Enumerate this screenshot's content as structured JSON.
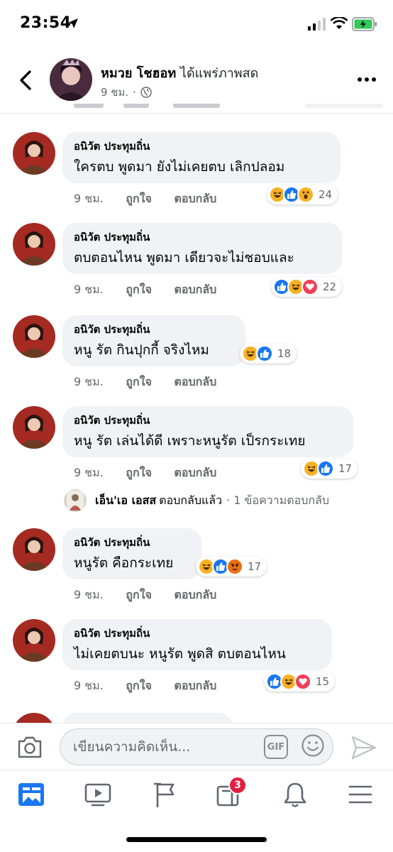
{
  "status_bar": {
    "time": "23:54"
  },
  "header": {
    "name": "หมวย โชฮอท",
    "action": "ได้แพร่ภาพสด",
    "time": "9 ชม.",
    "separator": "·"
  },
  "comments": [
    {
      "author": "อนิวัต ประทุมถิ่น",
      "text": "ใครตบ พูดมา ยังไม่เคยตบ เลิกปลอม",
      "time": "9 ชม.",
      "like_label": "ถูกใจ",
      "reply_label": "ตอบกลับ",
      "reactions": [
        "haha",
        "like",
        "wow"
      ],
      "reaction_count": "24"
    },
    {
      "author": "อนิวัต ประทุมถิ่น",
      "text": "ตบตอนไหน พูดมา เดียวจะไม่ชอบและ",
      "time": "9 ชม.",
      "like_label": "ถูกใจ",
      "reply_label": "ตอบกลับ",
      "reactions": [
        "like",
        "haha",
        "love"
      ],
      "reaction_count": "22"
    },
    {
      "author": "อนิวัต ประทุมถิ่น",
      "text": "หนู รัต กินปุกกี้ จริงไหม",
      "time": "9 ชม.",
      "like_label": "ถูกใจ",
      "reply_label": "ตอบกลับ",
      "reactions": [
        "haha",
        "like"
      ],
      "reaction_count": "18"
    },
    {
      "author": "อนิวัต ประทุมถิ่น",
      "text": "หนู รัต เล่นได้ดี เพราะหนูรัต เป็รกระเทย",
      "time": "9 ชม.",
      "like_label": "ถูกใจ",
      "reply_label": "ตอบกลับ",
      "reactions": [
        "haha",
        "like"
      ],
      "reaction_count": "17"
    },
    {
      "author": "อนิวัต ประทุมถิ่น",
      "text": "หนูรัต คือกระเทย",
      "time": "9 ชม.",
      "like_label": "ถูกใจ",
      "reply_label": "ตอบกลับ",
      "reactions": [
        "haha",
        "like",
        "angry"
      ],
      "reaction_count": "17"
    },
    {
      "author": "อนิวัต ประทุมถิ่น",
      "text": "ไม่เคยตบนะ หนูรัต พูดสิ ตบตอนไหน",
      "time": "9 ชม.",
      "like_label": "ถูกใจ",
      "reply_label": "ตอบกลับ",
      "reactions": [
        "like",
        "haha",
        "love"
      ],
      "reaction_count": "15"
    }
  ],
  "reply_thread": {
    "name": "เอ็น'เอ เอสส",
    "text": "ตอบกลับแล้ว",
    "count": "· 1 ข้อความตอบกลับ"
  },
  "composer": {
    "placeholder": "เขียนความคิดเห็น...",
    "gif_label": "GIF"
  },
  "tabbar": {
    "notifications_badge": "3"
  },
  "colors": {
    "brand": "#1877f2",
    "bubble": "#f0f2f5",
    "secondary_text": "#65676b",
    "badge": "#e41e3f"
  }
}
